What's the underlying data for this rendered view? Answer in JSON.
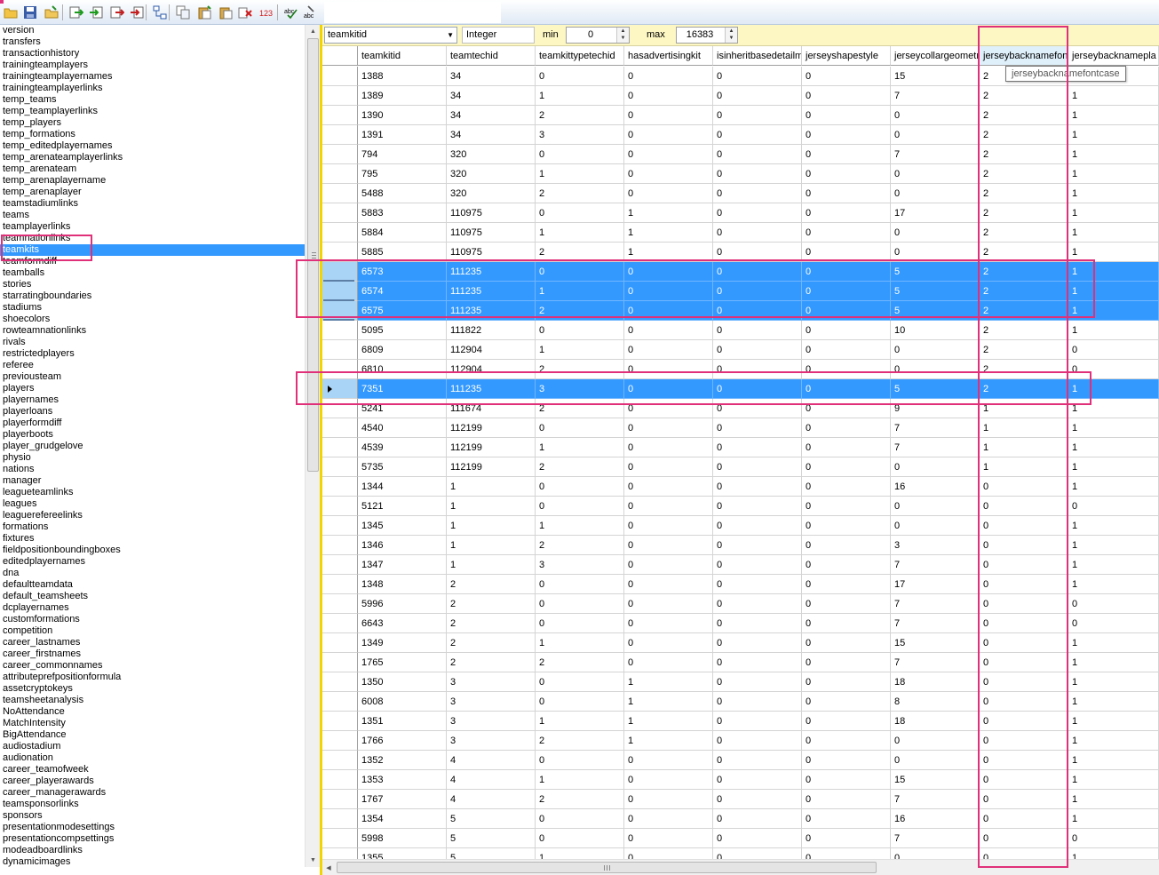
{
  "toolbar": {
    "icons": [
      "open-folder-icon",
      "save-icon",
      "open-icon",
      "import-icon",
      "export-icon",
      "delete-table-icon",
      "export-all-icon",
      "tree-icon",
      "copy-icon",
      "paste-icon",
      "paste-special-icon",
      "delete-icon",
      "numeric-icon",
      "spellcheck-icon",
      "spellcheck-replace-icon"
    ],
    "num_label": "123",
    "abc_label": "abc"
  },
  "table_list": {
    "items": [
      "version",
      "transfers",
      "transactionhistory",
      "trainingteamplayers",
      "trainingteamplayernames",
      "trainingteamplayerlinks",
      "temp_teams",
      "temp_teamplayerlinks",
      "temp_players",
      "temp_formations",
      "temp_editedplayernames",
      "temp_arenateamplayerlinks",
      "temp_arenateam",
      "temp_arenaplayername",
      "temp_arenaplayer",
      "teamstadiumlinks",
      "teams",
      "teamplayerlinks",
      "teamnationlinks",
      "teamkits",
      "teamformdiff",
      "teamballs",
      "stories",
      "starratingboundaries",
      "stadiums",
      "shoecolors",
      "rowteamnationlinks",
      "rivals",
      "restrictedplayers",
      "referee",
      "previousteam",
      "players",
      "playernames",
      "playerloans",
      "playerformdiff",
      "playerboots",
      "player_grudgelove",
      "physio",
      "nations",
      "manager",
      "leagueteamlinks",
      "leagues",
      "leaguerefereelinks",
      "formations",
      "fixtures",
      "fieldpositionboundingboxes",
      "editedplayernames",
      "dna",
      "defaultteamdata",
      "default_teamsheets",
      "dcplayernames",
      "customformations",
      "competition",
      "career_lastnames",
      "career_firstnames",
      "career_commonnames",
      "attributeprefpositionformula",
      "assetcryptokeys",
      "teamsheetanalysis",
      "NoAttendance",
      "MatchIntensity",
      "BigAttendance",
      "audiostadium",
      "audionation",
      "career_teamofweek",
      "career_playerawards",
      "career_managerawards",
      "teamsponsorlinks",
      "sponsors",
      "presentationmodesettings",
      "presentationcompsettings",
      "modeadboardlinks",
      "dynamicimages"
    ],
    "selected": "teamkits"
  },
  "filter": {
    "field": "teamkitid",
    "type": "Integer",
    "min_label": "min",
    "min_value": "0",
    "max_label": "max",
    "max_value": "16383"
  },
  "grid": {
    "columns": [
      "teamkitid",
      "teamtechid",
      "teamkittypetechid",
      "hasadvertisingkit",
      "isinheritbasedetailm",
      "jerseyshapestyle",
      "jerseycollargeometr",
      "jerseybacknamefon",
      "jerseybacknamepla"
    ],
    "highlighted_column": "jerseybacknamefon",
    "tooltip": "jerseybacknamefontcase",
    "rows": [
      [
        "1388",
        "34",
        "0",
        "0",
        "0",
        "0",
        "15",
        "2",
        ""
      ],
      [
        "1389",
        "34",
        "1",
        "0",
        "0",
        "0",
        "7",
        "2",
        "1"
      ],
      [
        "1390",
        "34",
        "2",
        "0",
        "0",
        "0",
        "0",
        "2",
        "1"
      ],
      [
        "1391",
        "34",
        "3",
        "0",
        "0",
        "0",
        "0",
        "2",
        "1"
      ],
      [
        "794",
        "320",
        "0",
        "0",
        "0",
        "0",
        "7",
        "2",
        "1"
      ],
      [
        "795",
        "320",
        "1",
        "0",
        "0",
        "0",
        "0",
        "2",
        "1"
      ],
      [
        "5488",
        "320",
        "2",
        "0",
        "0",
        "0",
        "0",
        "2",
        "1"
      ],
      [
        "5883",
        "110975",
        "0",
        "1",
        "0",
        "0",
        "17",
        "2",
        "1"
      ],
      [
        "5884",
        "110975",
        "1",
        "1",
        "0",
        "0",
        "0",
        "2",
        "1"
      ],
      [
        "5885",
        "110975",
        "2",
        "1",
        "0",
        "0",
        "0",
        "2",
        "1"
      ],
      [
        "6573",
        "111235",
        "0",
        "0",
        "0",
        "0",
        "5",
        "2",
        "1"
      ],
      [
        "6574",
        "111235",
        "1",
        "0",
        "0",
        "0",
        "5",
        "2",
        "1"
      ],
      [
        "6575",
        "111235",
        "2",
        "0",
        "0",
        "0",
        "5",
        "2",
        "1"
      ],
      [
        "5095",
        "111822",
        "0",
        "0",
        "0",
        "0",
        "10",
        "2",
        "1"
      ],
      [
        "6809",
        "112904",
        "1",
        "0",
        "0",
        "0",
        "0",
        "2",
        "0"
      ],
      [
        "6810",
        "112904",
        "2",
        "0",
        "0",
        "0",
        "0",
        "2",
        "0"
      ],
      [
        "7351",
        "111235",
        "3",
        "0",
        "0",
        "0",
        "5",
        "2",
        "1"
      ],
      [
        "5241",
        "111674",
        "2",
        "0",
        "0",
        "0",
        "9",
        "1",
        "1"
      ],
      [
        "4540",
        "112199",
        "0",
        "0",
        "0",
        "0",
        "7",
        "1",
        "1"
      ],
      [
        "4539",
        "112199",
        "1",
        "0",
        "0",
        "0",
        "7",
        "1",
        "1"
      ],
      [
        "5735",
        "112199",
        "2",
        "0",
        "0",
        "0",
        "0",
        "1",
        "1"
      ],
      [
        "1344",
        "1",
        "0",
        "0",
        "0",
        "0",
        "16",
        "0",
        "1"
      ],
      [
        "5121",
        "1",
        "0",
        "0",
        "0",
        "0",
        "0",
        "0",
        "0"
      ],
      [
        "1345",
        "1",
        "1",
        "0",
        "0",
        "0",
        "0",
        "0",
        "1"
      ],
      [
        "1346",
        "1",
        "2",
        "0",
        "0",
        "0",
        "3",
        "0",
        "1"
      ],
      [
        "1347",
        "1",
        "3",
        "0",
        "0",
        "0",
        "7",
        "0",
        "1"
      ],
      [
        "1348",
        "2",
        "0",
        "0",
        "0",
        "0",
        "17",
        "0",
        "1"
      ],
      [
        "5996",
        "2",
        "0",
        "0",
        "0",
        "0",
        "7",
        "0",
        "0"
      ],
      [
        "6643",
        "2",
        "0",
        "0",
        "0",
        "0",
        "7",
        "0",
        "0"
      ],
      [
        "1349",
        "2",
        "1",
        "0",
        "0",
        "0",
        "15",
        "0",
        "1"
      ],
      [
        "1765",
        "2",
        "2",
        "0",
        "0",
        "0",
        "7",
        "0",
        "1"
      ],
      [
        "1350",
        "3",
        "0",
        "1",
        "0",
        "0",
        "18",
        "0",
        "1"
      ],
      [
        "6008",
        "3",
        "0",
        "1",
        "0",
        "0",
        "8",
        "0",
        "1"
      ],
      [
        "1351",
        "3",
        "1",
        "1",
        "0",
        "0",
        "18",
        "0",
        "1"
      ],
      [
        "1766",
        "3",
        "2",
        "1",
        "0",
        "0",
        "0",
        "0",
        "1"
      ],
      [
        "1352",
        "4",
        "0",
        "0",
        "0",
        "0",
        "0",
        "0",
        "1"
      ],
      [
        "1353",
        "4",
        "1",
        "0",
        "0",
        "0",
        "15",
        "0",
        "1"
      ],
      [
        "1767",
        "4",
        "2",
        "0",
        "0",
        "0",
        "7",
        "0",
        "1"
      ],
      [
        "1354",
        "5",
        "0",
        "0",
        "0",
        "0",
        "16",
        "0",
        "1"
      ],
      [
        "5998",
        "5",
        "0",
        "0",
        "0",
        "0",
        "7",
        "0",
        "0"
      ],
      [
        "1355",
        "5",
        "1",
        "0",
        "0",
        "0",
        "0",
        "0",
        "1"
      ]
    ],
    "selected_rows": [
      10,
      11,
      12,
      16
    ],
    "current_row": 16
  },
  "colors": {
    "selection": "#3399ff",
    "annotation": "#e0307a",
    "filter_bar": "#fdf7c4",
    "divider": "#f2d500"
  }
}
